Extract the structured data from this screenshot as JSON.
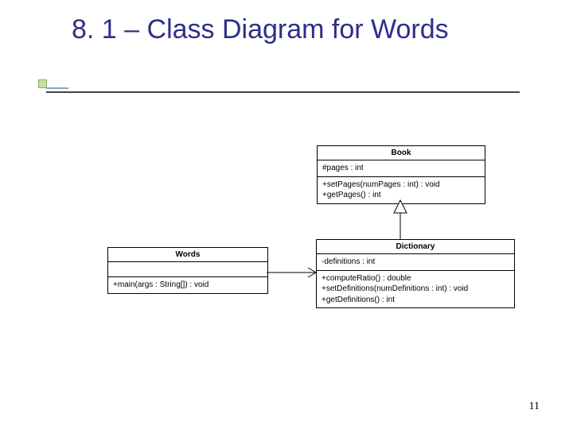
{
  "title": "8. 1 – Class Diagram for Words",
  "page_number": "11",
  "classes": {
    "book": {
      "name": "Book",
      "attributes": [
        "#pages : int"
      ],
      "operations": [
        "+setPages(numPages : int) : void",
        "+getPages() : int"
      ]
    },
    "dictionary": {
      "name": "Dictionary",
      "attributes": [
        "-definitions : int"
      ],
      "operations": [
        "+computeRatio() : double",
        "+setDefinitions(numDefinitions : int) : void",
        "+getDefinitions() : int"
      ]
    },
    "words": {
      "name": "Words",
      "attributes": [
        ""
      ],
      "operations": [
        "+main(args : String[]) : void"
      ]
    }
  }
}
